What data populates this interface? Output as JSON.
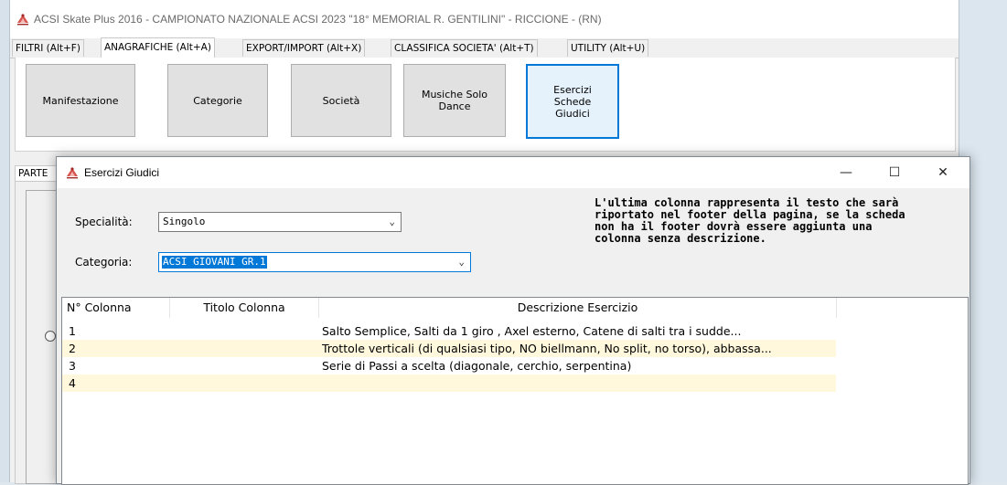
{
  "app": {
    "title": "ACSI Skate Plus 2016 - CAMPIONATO NAZIONALE ACSI 2023 \"18° MEMORIAL R. GENTILINI\" - RICCIONE - (RN)"
  },
  "tabs": [
    {
      "label": "FILTRI (Alt+F)"
    },
    {
      "label": "ANAGRAFICHE (Alt+A)"
    },
    {
      "label": "EXPORT/IMPORT (Alt+X)"
    },
    {
      "label": "CLASSIFICA SOCIETA' (Alt+T)"
    },
    {
      "label": "UTILITY (Alt+U)"
    }
  ],
  "buttons": [
    {
      "label": "Manifestazione"
    },
    {
      "label": "Categorie"
    },
    {
      "label": "Società"
    },
    {
      "label": "Musiche Solo\nDance"
    },
    {
      "label": "Esercizi\nSchede\nGiudici"
    }
  ],
  "lower_tab": {
    "label": "PARTE"
  },
  "dialog": {
    "title": "Esercizi Giudici",
    "controls": {
      "minimize": "—",
      "maximize": "☐",
      "close": "✕"
    },
    "specialita_label": "Specialità:",
    "specialita_value": "Singolo",
    "categoria_label": "Categoria:",
    "categoria_value": "ACSI GIOVANI GR.1",
    "info": "L'ultima colonna rappresenta il testo che sarà riportato nel footer della pagina, se la scheda non ha il footer dovrà essere aggiunta una colonna senza descrizione.",
    "grid": {
      "headers": [
        "N° Colonna",
        "Titolo Colonna",
        "Descrizione Esercizio"
      ],
      "rows": [
        {
          "num": "1",
          "titolo": "",
          "descrizione": "Salto Semplice, Salti da 1 giro , Axel esterno, Catene di salti tra i sudde..."
        },
        {
          "num": "2",
          "titolo": "",
          "descrizione": "Trottole verticali (di qualsiasi tipo, NO biellmann, No split, no torso), abbassa..."
        },
        {
          "num": "3",
          "titolo": "",
          "descrizione": "Serie di Passi a scelta (diagonale, cerchio, serpentina)"
        },
        {
          "num": "4",
          "titolo": "",
          "descrizione": ""
        }
      ]
    }
  },
  "colors": {
    "accent": "#0078d7",
    "row_alt": "#fff8dc",
    "selection": "#0078d7"
  },
  "icons": {
    "app": "skater-logo-icon"
  }
}
